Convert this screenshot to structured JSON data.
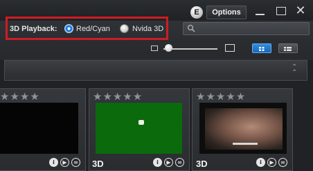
{
  "window": {
    "badge_letter": "E",
    "options_label": "Options"
  },
  "toolbar": {
    "playback_label": "3D Playback:",
    "options": [
      {
        "label": "Red/Cyan",
        "selected": true
      },
      {
        "label": "Nvida 3D",
        "selected": false
      }
    ],
    "search_placeholder": "",
    "highlight_color": "#d01c22"
  },
  "cards": [
    {
      "rating": "★★★★",
      "badge": ""
    },
    {
      "rating": "★★★★★",
      "badge": "3D"
    },
    {
      "rating": "★★★★★",
      "badge": "3D"
    }
  ],
  "icons": {
    "info": "i",
    "play": "▶",
    "share": "∞",
    "close": "✕",
    "collapse": "⌃"
  }
}
